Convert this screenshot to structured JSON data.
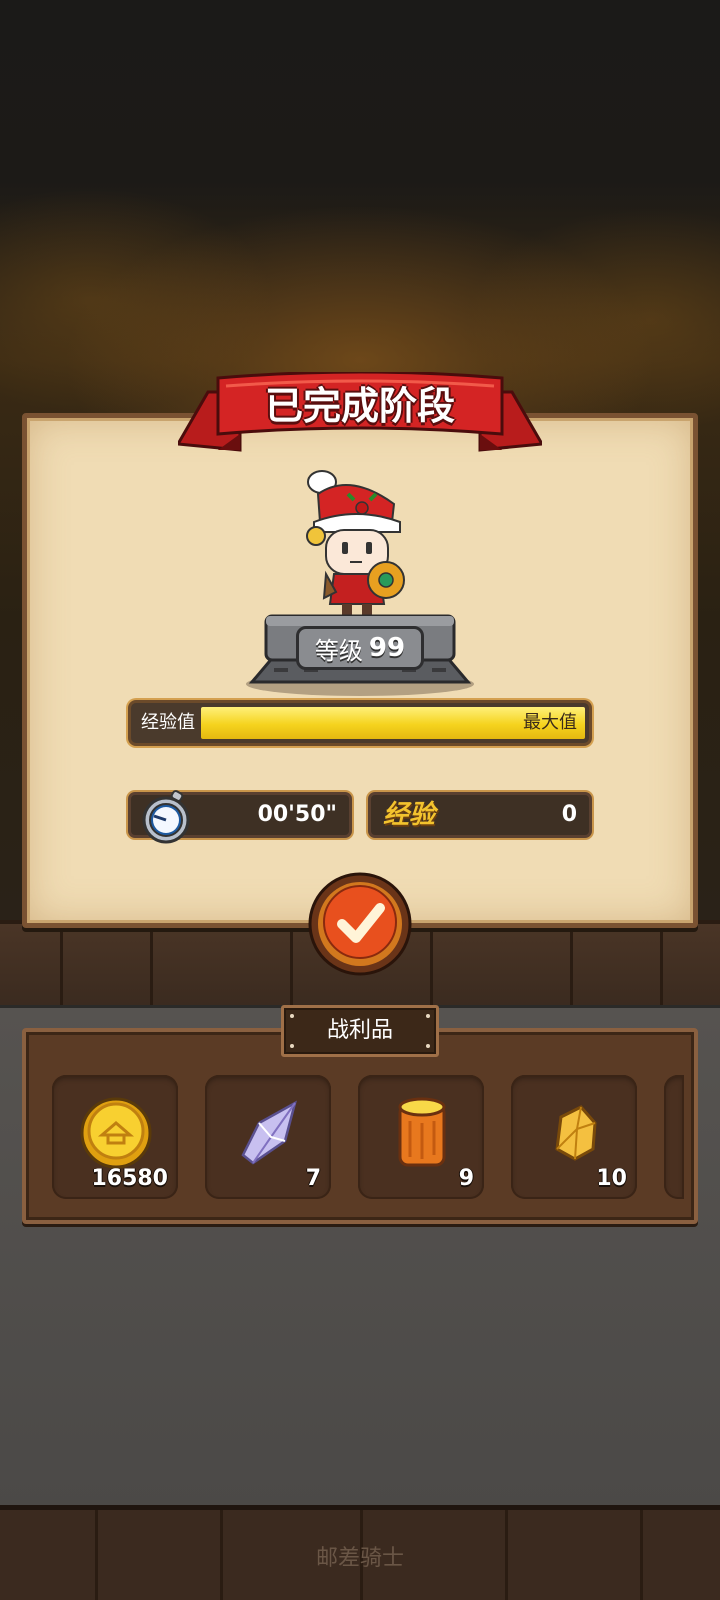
{
  "stage_result": {
    "title": "已完成阶段",
    "level_prefix": "等级",
    "level_value": "99",
    "exp_bar_label": "经验值",
    "exp_bar_status": "最大值",
    "exp_progress": 1.0,
    "time_value": "00'50\"",
    "exp_word": "经验",
    "exp_gained": "0"
  },
  "loot": {
    "title": "战利品",
    "items": [
      {
        "icon": "gold-coin-icon",
        "count": "16580"
      },
      {
        "icon": "crystal-icon",
        "count": "7"
      },
      {
        "icon": "wood-log-icon",
        "count": "9"
      },
      {
        "icon": "gold-ore-icon",
        "count": "10"
      }
    ]
  },
  "footer": {
    "character_name": "邮差骑士"
  },
  "colors": {
    "accent_red": "#d42424",
    "panel": "#f0dcb4",
    "exp_fill": "#f5d31e",
    "confirm": "#e8501e"
  }
}
